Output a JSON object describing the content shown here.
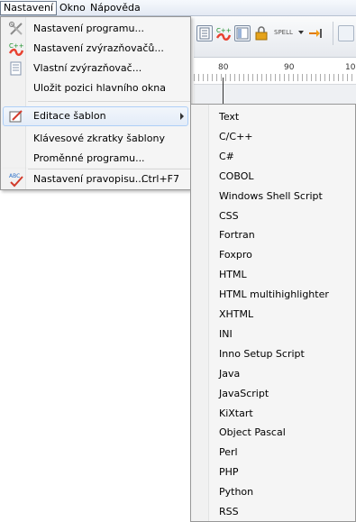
{
  "menubar": {
    "items": [
      {
        "label": "Nastavení"
      },
      {
        "label": "Okno"
      },
      {
        "label": "Nápověda"
      }
    ]
  },
  "ruler": {
    "labels": [
      "80",
      "90",
      "10"
    ]
  },
  "toolbar": {
    "spell_label": "SPELL"
  },
  "settings_menu": {
    "items": [
      {
        "label": "Nastavení programu...",
        "icon": "tools-icon"
      },
      {
        "label": "Nastavení zvýrazňovačů...",
        "icon": "highlighters-icon"
      },
      {
        "label": "Vlastní zvýrazňovač...",
        "icon": "custom-highlighter-icon"
      },
      {
        "label": "Uložit pozici hlavního okna",
        "icon": ""
      },
      {
        "label": "Editace šablon",
        "icon": "template-edit-icon",
        "has_submenu": true
      },
      {
        "label": "Klávesové zkratky šablony",
        "icon": ""
      },
      {
        "label": "Proměnné programu...",
        "icon": ""
      },
      {
        "label": "Nastavení pravopisu...",
        "icon": "spellcheck-icon",
        "shortcut": "Ctrl+F7"
      }
    ]
  },
  "templates_submenu": {
    "items": [
      "Text",
      "C/C++",
      "C#",
      "COBOL",
      "Windows Shell Script",
      "CSS",
      "Fortran",
      "Foxpro",
      "HTML",
      "HTML multihighlighter",
      "XHTML",
      "INI",
      "Inno Setup Script",
      "Java",
      "JavaScript",
      "KiXtart",
      "Object Pascal",
      "Perl",
      "PHP",
      "Python",
      "RSS"
    ]
  },
  "colors": {
    "highlight_border": "#aecff7",
    "menu_bg": "#f5f5f5",
    "marker_yellow": "#ffec00"
  }
}
